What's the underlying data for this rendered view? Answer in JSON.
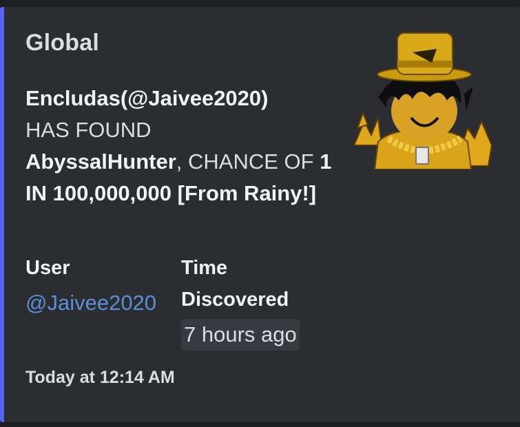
{
  "embed": {
    "accent_color": "#5865f2",
    "title": "Global",
    "description": {
      "user_display": "Encludas(@Jaivee2020)",
      "has_found": "HAS FOUND",
      "item": "AbyssalHunter",
      "chance_prefix": ", CHANCE OF ",
      "chance": "1 IN 100,000,000 [From Rainy!]"
    },
    "fields": [
      {
        "name": "User",
        "value": "@Jaivee2020"
      },
      {
        "name": "Time Discovered",
        "value": "7 hours ago"
      }
    ],
    "footer": "Today at 12:14 AM",
    "thumbnail": "roblox-avatar-gold-top-hat"
  }
}
